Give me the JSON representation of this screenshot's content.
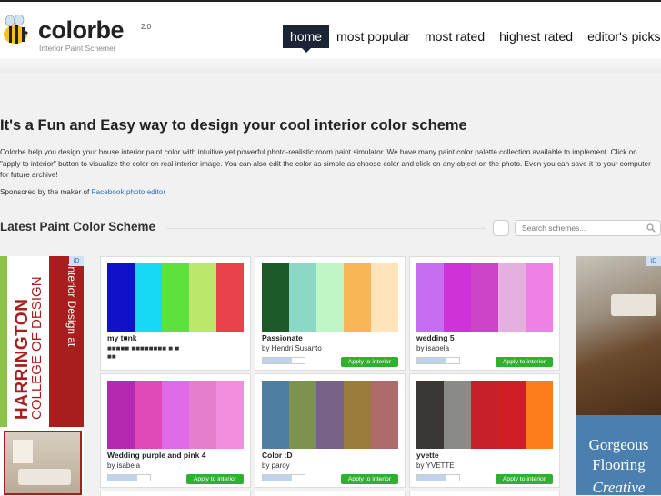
{
  "header": {
    "logo_text": "colorbe",
    "logo_version": "2.0",
    "logo_tagline": "Interior Paint Schemer",
    "nav": [
      {
        "label": "home",
        "active": true
      },
      {
        "label": "most popular",
        "active": false
      },
      {
        "label": "most rated",
        "active": false
      },
      {
        "label": "highest rated",
        "active": false
      },
      {
        "label": "editor's picks",
        "active": false
      }
    ]
  },
  "intro": {
    "headline": "It's a Fun and Easy way to design your cool interior color scheme",
    "body": "Colorbe help you design your house interior paint color with intuitive yet powerful photo-realistic room paint simulator. We have many paint color palette collection available to implement. Click on \"apply to interior\" button to visualize the color on real interior image. You can also edit the color as simple as choose color and click on any object on the photo. Even you can save it to your computer for future archive!",
    "sponsor_prefix": "Sponsored by the maker of",
    "sponsor_link": "Facebook photo editor"
  },
  "section": {
    "title": "Latest Paint Color Scheme",
    "search_placeholder": "Search schemes..."
  },
  "cards": [
    {
      "title": "my t■nk",
      "author": "■■■■■ ■■■■■■■■ ■  ■",
      "author2": "■■",
      "colors": [
        "#1111c9",
        "#17d9f5",
        "#5ee03d",
        "#b9e86b",
        "#e8434b"
      ],
      "apply_label": "Apply to interior"
    },
    {
      "title": "Passionate",
      "author": "by Hendri Susanto",
      "colors": [
        "#1d5a2a",
        "#8cd8c6",
        "#bff6c6",
        "#f8b656",
        "#fde4bb"
      ],
      "apply_label": "Apply to interior"
    },
    {
      "title": "wedding 5",
      "author": "by isabela",
      "colors": [
        "#c66cf0",
        "#ce33d9",
        "#cd44c6",
        "#e3b0df",
        "#ee80e6"
      ],
      "apply_label": "Apply to interior"
    },
    {
      "title": "Wedding purple and pink 4",
      "author": "by isabela",
      "colors": [
        "#b529b1",
        "#e04ab8",
        "#dd6ae6",
        "#e47ecd",
        "#f28de0"
      ],
      "apply_label": "Apply to interior"
    },
    {
      "title": "Color :D",
      "author": "by paroy",
      "colors": [
        "#4f7ea3",
        "#7c924f",
        "#786288",
        "#9a7b3c",
        "#ae6b6b"
      ],
      "apply_label": "Apply to interior"
    },
    {
      "title": "yvette",
      "author": "by YVETTE",
      "colors": [
        "#3b3735",
        "#8a8a87",
        "#c8202a",
        "#cf1e24",
        "#fb7d1c"
      ],
      "apply_label": "Apply to interior"
    }
  ],
  "ads": {
    "left_badge": "iD",
    "left_line1": "HARRINGTON",
    "left_line2": "COLLEGE OF DESIGN",
    "left_line3": "Interior Design at",
    "right_badge": "iD",
    "right_line1": "Gorgeous",
    "right_line2": "Flooring",
    "right_line3": "Creative"
  }
}
